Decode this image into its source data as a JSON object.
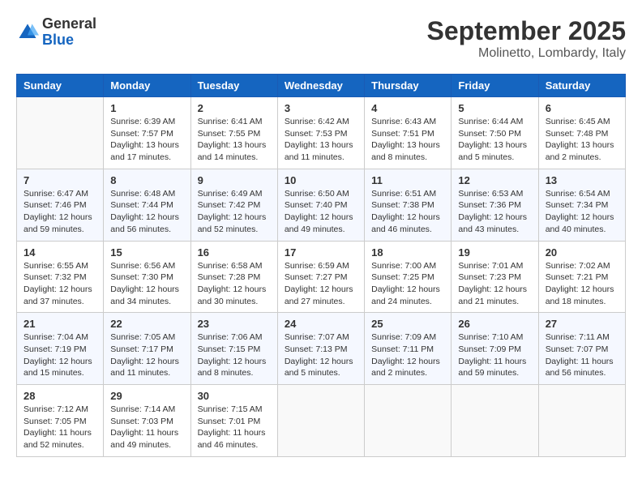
{
  "logo": {
    "general": "General",
    "blue": "Blue"
  },
  "title": "September 2025",
  "subtitle": "Molinetto, Lombardy, Italy",
  "days_of_week": [
    "Sunday",
    "Monday",
    "Tuesday",
    "Wednesday",
    "Thursday",
    "Friday",
    "Saturday"
  ],
  "weeks": [
    [
      {
        "day": "",
        "info": ""
      },
      {
        "day": "1",
        "info": "Sunrise: 6:39 AM\nSunset: 7:57 PM\nDaylight: 13 hours\nand 17 minutes."
      },
      {
        "day": "2",
        "info": "Sunrise: 6:41 AM\nSunset: 7:55 PM\nDaylight: 13 hours\nand 14 minutes."
      },
      {
        "day": "3",
        "info": "Sunrise: 6:42 AM\nSunset: 7:53 PM\nDaylight: 13 hours\nand 11 minutes."
      },
      {
        "day": "4",
        "info": "Sunrise: 6:43 AM\nSunset: 7:51 PM\nDaylight: 13 hours\nand 8 minutes."
      },
      {
        "day": "5",
        "info": "Sunrise: 6:44 AM\nSunset: 7:50 PM\nDaylight: 13 hours\nand 5 minutes."
      },
      {
        "day": "6",
        "info": "Sunrise: 6:45 AM\nSunset: 7:48 PM\nDaylight: 13 hours\nand 2 minutes."
      }
    ],
    [
      {
        "day": "7",
        "info": "Sunrise: 6:47 AM\nSunset: 7:46 PM\nDaylight: 12 hours\nand 59 minutes."
      },
      {
        "day": "8",
        "info": "Sunrise: 6:48 AM\nSunset: 7:44 PM\nDaylight: 12 hours\nand 56 minutes."
      },
      {
        "day": "9",
        "info": "Sunrise: 6:49 AM\nSunset: 7:42 PM\nDaylight: 12 hours\nand 52 minutes."
      },
      {
        "day": "10",
        "info": "Sunrise: 6:50 AM\nSunset: 7:40 PM\nDaylight: 12 hours\nand 49 minutes."
      },
      {
        "day": "11",
        "info": "Sunrise: 6:51 AM\nSunset: 7:38 PM\nDaylight: 12 hours\nand 46 minutes."
      },
      {
        "day": "12",
        "info": "Sunrise: 6:53 AM\nSunset: 7:36 PM\nDaylight: 12 hours\nand 43 minutes."
      },
      {
        "day": "13",
        "info": "Sunrise: 6:54 AM\nSunset: 7:34 PM\nDaylight: 12 hours\nand 40 minutes."
      }
    ],
    [
      {
        "day": "14",
        "info": "Sunrise: 6:55 AM\nSunset: 7:32 PM\nDaylight: 12 hours\nand 37 minutes."
      },
      {
        "day": "15",
        "info": "Sunrise: 6:56 AM\nSunset: 7:30 PM\nDaylight: 12 hours\nand 34 minutes."
      },
      {
        "day": "16",
        "info": "Sunrise: 6:58 AM\nSunset: 7:28 PM\nDaylight: 12 hours\nand 30 minutes."
      },
      {
        "day": "17",
        "info": "Sunrise: 6:59 AM\nSunset: 7:27 PM\nDaylight: 12 hours\nand 27 minutes."
      },
      {
        "day": "18",
        "info": "Sunrise: 7:00 AM\nSunset: 7:25 PM\nDaylight: 12 hours\nand 24 minutes."
      },
      {
        "day": "19",
        "info": "Sunrise: 7:01 AM\nSunset: 7:23 PM\nDaylight: 12 hours\nand 21 minutes."
      },
      {
        "day": "20",
        "info": "Sunrise: 7:02 AM\nSunset: 7:21 PM\nDaylight: 12 hours\nand 18 minutes."
      }
    ],
    [
      {
        "day": "21",
        "info": "Sunrise: 7:04 AM\nSunset: 7:19 PM\nDaylight: 12 hours\nand 15 minutes."
      },
      {
        "day": "22",
        "info": "Sunrise: 7:05 AM\nSunset: 7:17 PM\nDaylight: 12 hours\nand 11 minutes."
      },
      {
        "day": "23",
        "info": "Sunrise: 7:06 AM\nSunset: 7:15 PM\nDaylight: 12 hours\nand 8 minutes."
      },
      {
        "day": "24",
        "info": "Sunrise: 7:07 AM\nSunset: 7:13 PM\nDaylight: 12 hours\nand 5 minutes."
      },
      {
        "day": "25",
        "info": "Sunrise: 7:09 AM\nSunset: 7:11 PM\nDaylight: 12 hours\nand 2 minutes."
      },
      {
        "day": "26",
        "info": "Sunrise: 7:10 AM\nSunset: 7:09 PM\nDaylight: 11 hours\nand 59 minutes."
      },
      {
        "day": "27",
        "info": "Sunrise: 7:11 AM\nSunset: 7:07 PM\nDaylight: 11 hours\nand 56 minutes."
      }
    ],
    [
      {
        "day": "28",
        "info": "Sunrise: 7:12 AM\nSunset: 7:05 PM\nDaylight: 11 hours\nand 52 minutes."
      },
      {
        "day": "29",
        "info": "Sunrise: 7:14 AM\nSunset: 7:03 PM\nDaylight: 11 hours\nand 49 minutes."
      },
      {
        "day": "30",
        "info": "Sunrise: 7:15 AM\nSunset: 7:01 PM\nDaylight: 11 hours\nand 46 minutes."
      },
      {
        "day": "",
        "info": ""
      },
      {
        "day": "",
        "info": ""
      },
      {
        "day": "",
        "info": ""
      },
      {
        "day": "",
        "info": ""
      }
    ]
  ]
}
